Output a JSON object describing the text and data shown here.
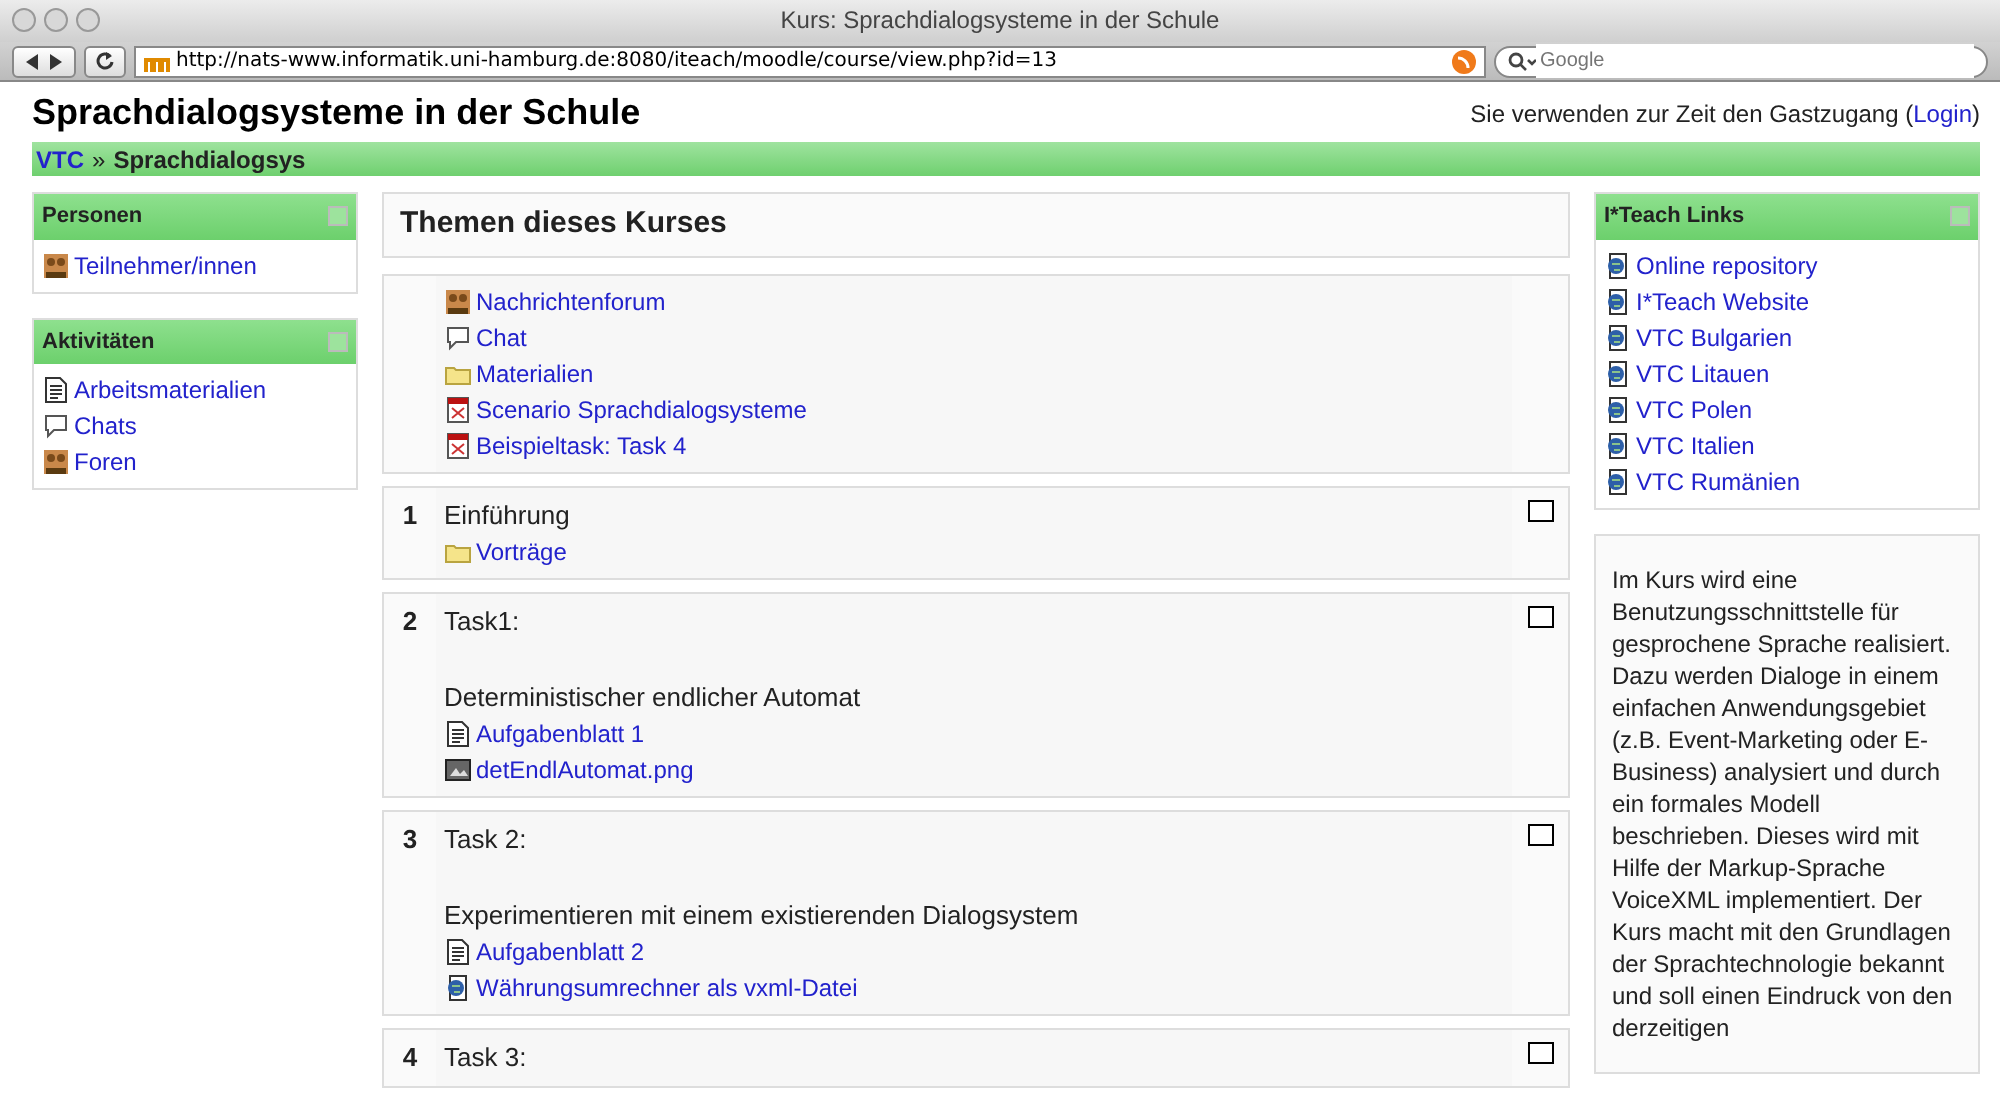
{
  "window": {
    "title": "Kurs: Sprachdialogsysteme in der Schule"
  },
  "toolbar": {
    "url": "http://nats-www.informatik.uni-hamburg.de:8080/iteach/moodle/course/view.php?id=13",
    "search_placeholder": "Google"
  },
  "header": {
    "title": "Sprachdialogsysteme in der Schule",
    "login_info": "Sie verwenden zur Zeit den Gastzugang (",
    "login_link": "Login",
    "login_close": ")"
  },
  "breadcrumb": [
    {
      "label": "VTC",
      "kind": "link"
    },
    {
      "label": "»",
      "kind": "sep"
    },
    {
      "label": "Sprachdialogsys",
      "kind": "current"
    }
  ],
  "left_blocks": [
    {
      "title": "Personen",
      "items": [
        {
          "label": "Teilnehmer/innen",
          "kind": "forum"
        }
      ]
    },
    {
      "title": "Aktivitäten",
      "items": [
        {
          "label": "Arbeitsmaterialien",
          "kind": "doc"
        },
        {
          "label": "Chats",
          "kind": "chat"
        },
        {
          "label": "Foren",
          "kind": "forum"
        }
      ]
    }
  ],
  "main": {
    "heading": "Themen dieses Kurses",
    "sections": [
      {
        "items": [
          {
            "label": "Nachrichtenforum",
            "kind": "forum"
          },
          {
            "label": "Chat",
            "kind": "chat"
          },
          {
            "label": "Materialien",
            "kind": "folder"
          },
          {
            "label": "Scenario Sprachdialogsysteme",
            "kind": "pdf"
          },
          {
            "label": "Beispieltask: Task 4",
            "kind": "pdf"
          }
        ]
      },
      {
        "number": "1",
        "highlighted": false,
        "items": [
          {
            "label": "Einführung",
            "kind": "text"
          },
          {
            "label": "Vorträge",
            "kind": "folder"
          }
        ]
      },
      {
        "number": "2",
        "highlighted": false,
        "items": [
          {
            "label": "Task1:",
            "kind": "text"
          },
          {
            "label": "Deterministischer endlicher Automat",
            "kind": "para"
          },
          {
            "label": "Aufgabenblatt 1",
            "kind": "doc"
          },
          {
            "label": "detEndlAutomat.png",
            "kind": "image"
          }
        ]
      },
      {
        "number": "3",
        "highlighted": false,
        "items": [
          {
            "label": "Task 2:",
            "kind": "text"
          },
          {
            "label": "Experimentieren mit einem existierenden Dialogsystem",
            "kind": "para"
          },
          {
            "label": "Aufgabenblatt 2",
            "kind": "doc"
          },
          {
            "label": "Währungsumrechner als vxml-Datei",
            "kind": "web"
          }
        ]
      },
      {
        "number": "4",
        "highlighted": false,
        "items": [
          {
            "label": "Task 3:",
            "kind": "text"
          }
        ]
      }
    ]
  },
  "right_blocks": [
    {
      "title": "I*Teach Links",
      "items": [
        {
          "label": "Online repository",
          "kind": "web"
        },
        {
          "label": "I*Teach Website",
          "kind": "web"
        },
        {
          "label": "VTC Bulgarien",
          "kind": "web"
        },
        {
          "label": "VTC Litauen",
          "kind": "web"
        },
        {
          "label": "VTC Polen",
          "kind": "web"
        },
        {
          "label": "VTC Italien",
          "kind": "web"
        },
        {
          "label": "VTC Rumänien",
          "kind": "web"
        }
      ]
    },
    {
      "text": "Im Kurs wird eine Benutzungsschnittstelle für gesprochene Sprache realisiert. Dazu werden Dialoge in einem einfachen Anwendungsgebiet (z.B. Event-Marketing oder E-Business) analysiert und durch ein formales Modell beschrieben. Dieses wird mit Hilfe der Markup-Sprache VoiceXML implementiert. Der Kurs macht mit den Grundlagen der Sprachtechnologie bekannt und soll einen Eindruck von den derzeitigen"
    }
  ]
}
